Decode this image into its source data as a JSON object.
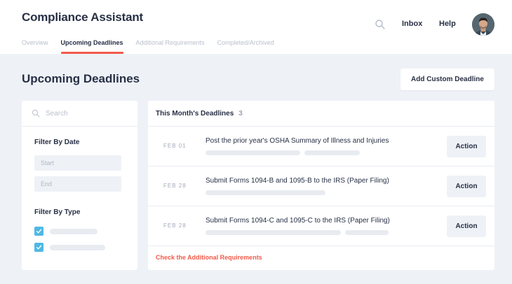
{
  "app": {
    "title": "Compliance Assistant"
  },
  "tabs": [
    {
      "label": "Overview"
    },
    {
      "label": "Upcoming Deadlines",
      "active": true
    },
    {
      "label": "Additional Requirements"
    },
    {
      "label": "Completed/Archived"
    }
  ],
  "topnav": {
    "inbox": "Inbox",
    "help": "Help"
  },
  "page": {
    "title": "Upcoming Deadlines",
    "add_button": "Add Custom Deadline"
  },
  "filters": {
    "search_placeholder": "Search",
    "date_heading": "Filter By Date",
    "start_placeholder": "Start",
    "end_placeholder": "End",
    "type_heading": "Filter By Type"
  },
  "deadlines": {
    "header": "This Month's Deadlines",
    "count": "3",
    "items": [
      {
        "date": "FEB 01",
        "title": "Post the prior year's OSHA Summary of Illness and Injuries",
        "action": "Action"
      },
      {
        "date": "FEB 28",
        "title": "Submit Forms 1094-B and 1095-B to the IRS (Paper Filing)",
        "action": "Action"
      },
      {
        "date": "FEB 28",
        "title": "Submit Forms 1094-C and 1095-C to the IRS (Paper Filing)",
        "action": "Action"
      }
    ],
    "footer_link": "Check the Additional Requirements"
  },
  "colors": {
    "accent": "#f25a49",
    "checkbox": "#4fb8e6",
    "background": "#eef2f7",
    "text": "#283045"
  }
}
